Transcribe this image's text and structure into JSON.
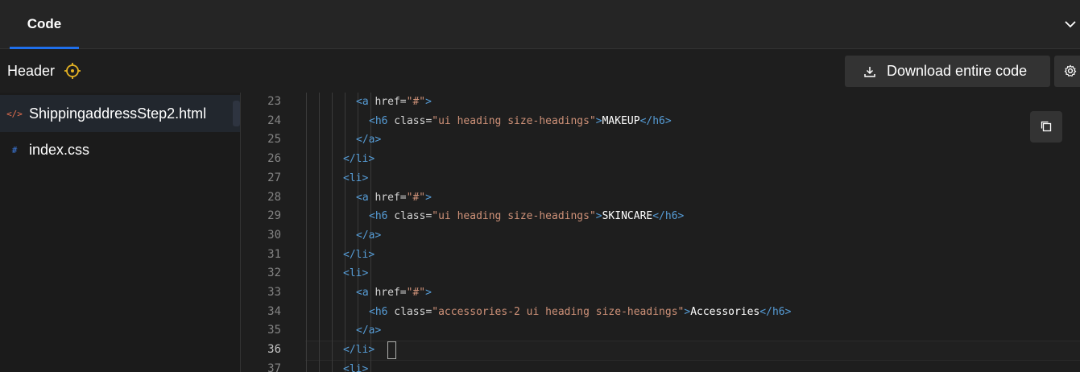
{
  "topbar": {
    "tab_label": "Code"
  },
  "header": {
    "label": "Header",
    "download_label": "Download entire code"
  },
  "files": [
    {
      "name": "ShippingaddressStep2.html",
      "icon": "</>",
      "active": true
    },
    {
      "name": "index.css",
      "icon": "#",
      "active": false
    }
  ],
  "editor": {
    "current_line": "36",
    "lines": [
      {
        "n": "23",
        "indent": 4,
        "tokens": [
          [
            "t-tag",
            "<"
          ],
          [
            "t-tag",
            "a"
          ],
          [
            "t-attr2",
            " href="
          ],
          [
            "t-str",
            "\"#\""
          ],
          [
            "t-tag",
            ">"
          ]
        ]
      },
      {
        "n": "24",
        "indent": 5,
        "tokens": [
          [
            "t-tag",
            "<"
          ],
          [
            "t-tag",
            "h6"
          ],
          [
            "t-attr2",
            " class="
          ],
          [
            "t-str",
            "\"ui heading size-headings\""
          ],
          [
            "t-tag",
            ">"
          ],
          [
            "t-text",
            "MAKEUP"
          ],
          [
            "t-tag",
            "</"
          ],
          [
            "t-tag",
            "h6"
          ],
          [
            "t-tag",
            ">"
          ]
        ]
      },
      {
        "n": "25",
        "indent": 4,
        "tokens": [
          [
            "t-tag",
            "</"
          ],
          [
            "t-tag",
            "a"
          ],
          [
            "t-tag",
            ">"
          ]
        ]
      },
      {
        "n": "26",
        "indent": 3,
        "tokens": [
          [
            "t-tag",
            "</"
          ],
          [
            "t-tag",
            "li"
          ],
          [
            "t-tag",
            ">"
          ]
        ]
      },
      {
        "n": "27",
        "indent": 3,
        "tokens": [
          [
            "t-tag",
            "<"
          ],
          [
            "t-tag",
            "li"
          ],
          [
            "t-tag",
            ">"
          ]
        ]
      },
      {
        "n": "28",
        "indent": 4,
        "tokens": [
          [
            "t-tag",
            "<"
          ],
          [
            "t-tag",
            "a"
          ],
          [
            "t-attr2",
            " href="
          ],
          [
            "t-str",
            "\"#\""
          ],
          [
            "t-tag",
            ">"
          ]
        ]
      },
      {
        "n": "29",
        "indent": 5,
        "tokens": [
          [
            "t-tag",
            "<"
          ],
          [
            "t-tag",
            "h6"
          ],
          [
            "t-attr2",
            " class="
          ],
          [
            "t-str",
            "\"ui heading size-headings\""
          ],
          [
            "t-tag",
            ">"
          ],
          [
            "t-text",
            "SKINCARE"
          ],
          [
            "t-tag",
            "</"
          ],
          [
            "t-tag",
            "h6"
          ],
          [
            "t-tag",
            ">"
          ]
        ]
      },
      {
        "n": "30",
        "indent": 4,
        "tokens": [
          [
            "t-tag",
            "</"
          ],
          [
            "t-tag",
            "a"
          ],
          [
            "t-tag",
            ">"
          ]
        ]
      },
      {
        "n": "31",
        "indent": 3,
        "tokens": [
          [
            "t-tag",
            "</"
          ],
          [
            "t-tag",
            "li"
          ],
          [
            "t-tag",
            ">"
          ]
        ]
      },
      {
        "n": "32",
        "indent": 3,
        "tokens": [
          [
            "t-tag",
            "<"
          ],
          [
            "t-tag",
            "li"
          ],
          [
            "t-tag",
            ">"
          ]
        ]
      },
      {
        "n": "33",
        "indent": 4,
        "tokens": [
          [
            "t-tag",
            "<"
          ],
          [
            "t-tag",
            "a"
          ],
          [
            "t-attr2",
            " href="
          ],
          [
            "t-str",
            "\"#\""
          ],
          [
            "t-tag",
            ">"
          ]
        ]
      },
      {
        "n": "34",
        "indent": 5,
        "tokens": [
          [
            "t-tag",
            "<"
          ],
          [
            "t-tag",
            "h6"
          ],
          [
            "t-attr2",
            " class="
          ],
          [
            "t-str",
            "\"accessories-2 ui heading size-headings\""
          ],
          [
            "t-tag",
            ">"
          ],
          [
            "t-text",
            "Accessories"
          ],
          [
            "t-tag",
            "</"
          ],
          [
            "t-tag",
            "h6"
          ],
          [
            "t-tag",
            ">"
          ]
        ]
      },
      {
        "n": "35",
        "indent": 4,
        "tokens": [
          [
            "t-tag",
            "</"
          ],
          [
            "t-tag",
            "a"
          ],
          [
            "t-tag",
            ">"
          ]
        ]
      },
      {
        "n": "36",
        "indent": 3,
        "tokens": [
          [
            "t-tag",
            "</"
          ],
          [
            "t-tag",
            "li"
          ],
          [
            "t-tag",
            ">"
          ]
        ]
      },
      {
        "n": "37",
        "indent": 3,
        "tokens": [
          [
            "t-tag",
            "<"
          ],
          [
            "t-tag",
            "li"
          ],
          [
            "t-tag",
            ">"
          ]
        ]
      }
    ]
  },
  "colors": {
    "accent": "#1f6feb",
    "tag": "#569cd6",
    "string": "#ce9178",
    "icon_yellow": "#e5b323",
    "html_icon": "#e8704f",
    "css_icon": "#3d7be0"
  }
}
